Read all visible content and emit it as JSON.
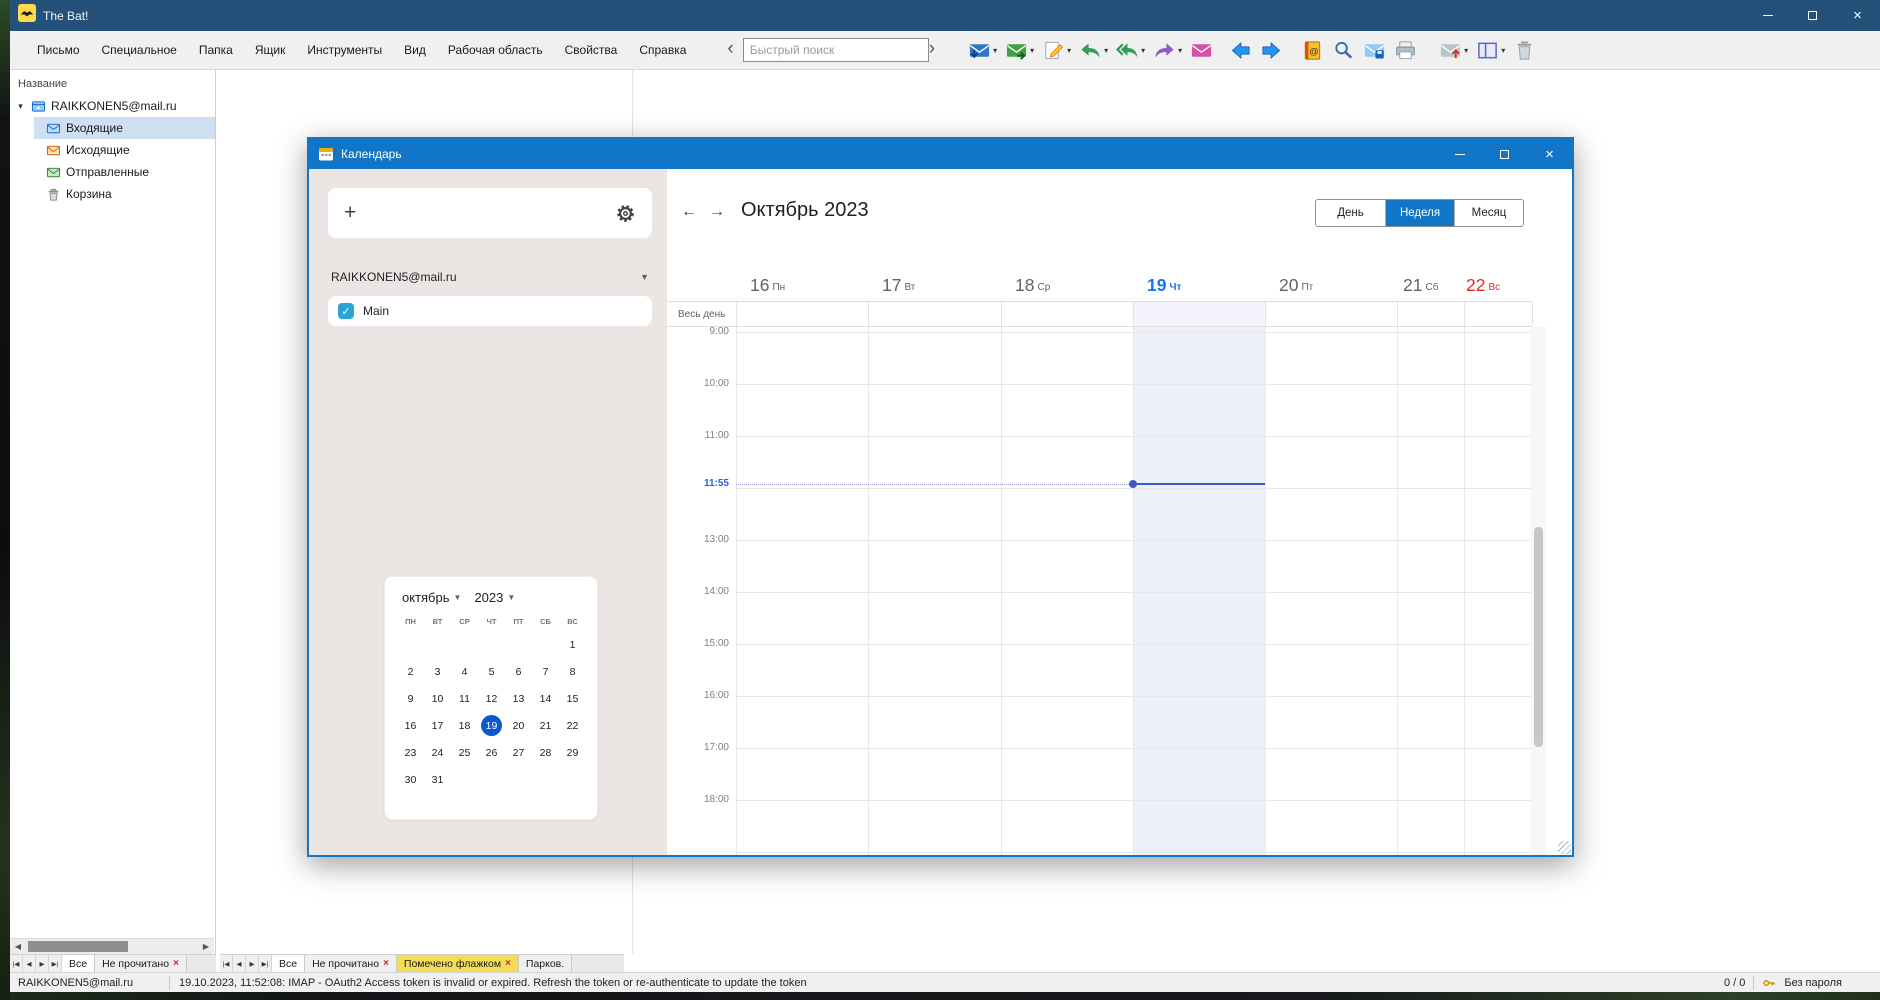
{
  "app": {
    "title": "The Bat!",
    "menu": [
      "Письмо",
      "Специальное",
      "Папка",
      "Ящик",
      "Инструменты",
      "Вид",
      "Рабочая область",
      "Свойства",
      "Справка"
    ],
    "toolbar": {
      "collapse_left": "‹",
      "collapse_right": "›",
      "search_placeholder": "Быстрый поиск",
      "buttons": [
        {
          "name": "check-mail",
          "icon": "envelope-down-icon",
          "color": "#2f78c8",
          "dropdown": true
        },
        {
          "name": "queue-mail",
          "icon": "envelope-out-icon",
          "color": "#43a047",
          "dropdown": true
        },
        {
          "name": "new-message",
          "icon": "compose-icon",
          "color": "#ffca28",
          "dropdown": true
        },
        {
          "name": "reply",
          "icon": "reply-icon",
          "color": "#2e9e4f",
          "dropdown": true
        },
        {
          "name": "reply-all",
          "icon": "reply-all-icon",
          "color": "#2e9e4f",
          "dropdown": true
        },
        {
          "name": "forward",
          "icon": "forward-icon",
          "color": "#8e5bc8",
          "dropdown": true
        },
        {
          "name": "redirect",
          "icon": "envelope-redirect-icon",
          "color": "#d64fa8",
          "dropdown": false
        },
        {
          "name": "previous-message",
          "icon": "arrow-left-icon",
          "color": "#2196f3",
          "dropdown": false
        },
        {
          "name": "next-message",
          "icon": "arrow-right-icon",
          "color": "#2196f3",
          "dropdown": false
        },
        {
          "name": "address-book",
          "icon": "address-book-icon",
          "color": "#fbc02d",
          "dropdown": false
        },
        {
          "name": "search-messages",
          "icon": "magnifier-icon",
          "color": "#3b6ea5",
          "dropdown": false
        },
        {
          "name": "save-message",
          "icon": "envelope-save-icon",
          "color": "#90caf9",
          "dropdown": false
        },
        {
          "name": "print-message",
          "icon": "printer-icon",
          "color": "#b0bec5",
          "dropdown": false
        },
        {
          "name": "move-message",
          "icon": "envelope-up-icon",
          "color": "#b8c4cc",
          "dropdown": true
        },
        {
          "name": "window-layout",
          "icon": "panes-icon",
          "color": "#5c6bc0",
          "dropdown": true
        },
        {
          "name": "delete-message",
          "icon": "trash-icon",
          "color": "#9e9e9e",
          "dropdown": false
        }
      ]
    },
    "tree": {
      "header": "Название",
      "account": "RAIKKONEN5@mail.ru",
      "folders": [
        {
          "label": "Входящие",
          "icon": "inbox-icon",
          "selected": true
        },
        {
          "label": "Исходящие",
          "icon": "outbox-icon",
          "selected": false
        },
        {
          "label": "Отправленные",
          "icon": "sent-icon",
          "selected": false
        },
        {
          "label": "Корзина",
          "icon": "trash-small-icon",
          "selected": false
        }
      ]
    },
    "folder_tabs": {
      "nav": [
        "|◀",
        "◀",
        "▶",
        "▶|"
      ],
      "tabs": [
        {
          "label": "Все",
          "close": false,
          "active": true,
          "highlight": ""
        },
        {
          "label": "Не прочитано",
          "close": true,
          "active": false,
          "highlight": ""
        }
      ]
    },
    "list_tabs": {
      "nav": [
        "|◀",
        "◀",
        "▶",
        "▶|"
      ],
      "tabs": [
        {
          "label": "Все",
          "close": false,
          "active": true,
          "highlight": ""
        },
        {
          "label": "Не прочитано",
          "close": true,
          "active": false,
          "highlight": ""
        },
        {
          "label": "Помечено флажком",
          "close": true,
          "active": false,
          "highlight": "#f3dd55"
        },
        {
          "label": "Парков.",
          "close": false,
          "active": false,
          "highlight": ""
        }
      ]
    },
    "status": {
      "account": "RAIKKONEN5@mail.ru",
      "message": "19.10.2023, 11:52:08: IMAP   - OAuth2 Access token is invalid or expired. Refresh the token or re-authenticate to update the token",
      "counter": "0 / 0",
      "password_mode": "Без пароля"
    }
  },
  "calendar": {
    "title": "Календарь",
    "sidebar": {
      "add_button": "+",
      "account": "RAIKKONEN5@mail.ru",
      "calendars": [
        {
          "label": "Main",
          "checked": true,
          "color": "#2ba3d4"
        }
      ],
      "mini_calendar": {
        "month": "октябрь",
        "year": "2023",
        "weekdays": [
          "ПН",
          "ВТ",
          "СР",
          "ЧТ",
          "ПТ",
          "СБ",
          "ВС"
        ],
        "weeks": [
          [
            "",
            "",
            "",
            "",
            "",
            "",
            "1"
          ],
          [
            "2",
            "3",
            "4",
            "5",
            "6",
            "7",
            "8"
          ],
          [
            "9",
            "10",
            "11",
            "12",
            "13",
            "14",
            "15"
          ],
          [
            "16",
            "17",
            "18",
            "19",
            "20",
            "21",
            "22"
          ],
          [
            "23",
            "24",
            "25",
            "26",
            "27",
            "28",
            "29"
          ],
          [
            "30",
            "31",
            "",
            "",
            "",
            "",
            ""
          ]
        ],
        "selected_day": "19"
      }
    },
    "main": {
      "prev": "←",
      "next": "→",
      "title": "Октябрь 2023",
      "views": [
        {
          "label": "День",
          "active": false
        },
        {
          "label": "Неделя",
          "active": true
        },
        {
          "label": "Месяц",
          "active": false
        }
      ],
      "all_day_label": "Весь день",
      "days": [
        {
          "num": "16",
          "wd": "Пн",
          "type": "normal"
        },
        {
          "num": "17",
          "wd": "Вт",
          "type": "normal"
        },
        {
          "num": "18",
          "wd": "Ср",
          "type": "normal"
        },
        {
          "num": "19",
          "wd": "Чт",
          "type": "today"
        },
        {
          "num": "20",
          "wd": "Пт",
          "type": "normal"
        },
        {
          "num": "21",
          "wd": "Сб",
          "type": "normal"
        },
        {
          "num": "22",
          "wd": "Вс",
          "type": "sunday"
        }
      ],
      "hour_labels": [
        "9:00",
        "10:00",
        "11:00",
        "",
        "13:00",
        "14:00",
        "15:00",
        "16:00",
        "17:00",
        "18:00",
        ""
      ],
      "current_time": "11:55"
    },
    "colors": {
      "accent": "#1176c8",
      "today_blue": "#1a73e8",
      "sunday_red": "#d93025",
      "today_column_bg": "#edeffa"
    }
  }
}
